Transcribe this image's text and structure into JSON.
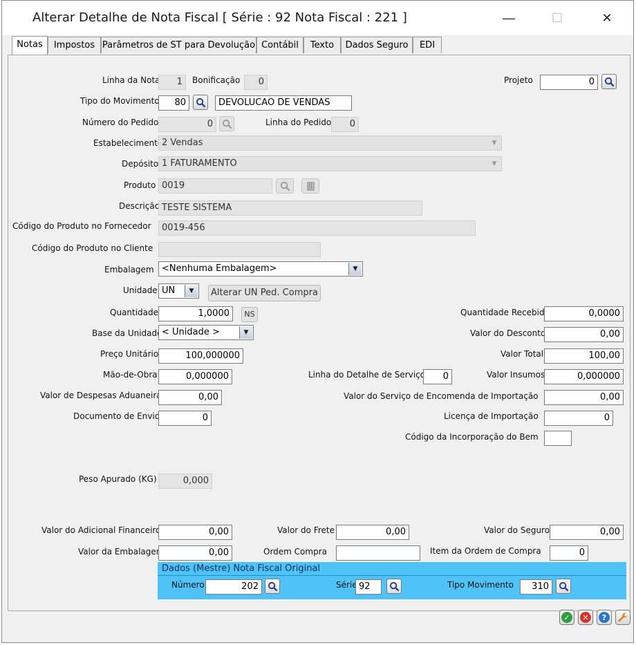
{
  "window": {
    "title": "Alterar Detalhe de Nota Fiscal [ Série : 92 Nota Fiscal : 221 ]",
    "minimize": "—",
    "maximize": "☐",
    "close": "✕"
  },
  "tabs": [
    "Notas",
    "Impostos",
    "Parâmetros de ST para Devolução",
    "Contábil",
    "Texto",
    "Dados Seguro",
    "EDI"
  ],
  "fields": {
    "linha_nota": {
      "label": "Linha da Nota",
      "value": "1"
    },
    "bonificacao": {
      "label": "Bonificação",
      "value": "0"
    },
    "projeto": {
      "label": "Projeto",
      "value": "0"
    },
    "tipo_movimento": {
      "label": "Tipo do Movimento",
      "value": "80",
      "desc": "DEVOLUCAO DE VENDAS"
    },
    "numero_pedido": {
      "label": "Número do Pedido",
      "value": "0"
    },
    "linha_pedido": {
      "label": "Linha do Pedido",
      "value": "0"
    },
    "estabelecimento": {
      "label": "Estabelecimento",
      "value": "2 Vendas"
    },
    "deposito": {
      "label": "Depósito",
      "value": "1 FATURAMENTO"
    },
    "produto": {
      "label": "Produto",
      "value": "0019"
    },
    "descricao": {
      "label": "Descrição",
      "value": "TESTE SISTEMA"
    },
    "cod_fornecedor": {
      "label": "Código do Produto no Fornecedor",
      "value": "0019-456"
    },
    "cod_cliente": {
      "label": "Código do Produto no Cliente",
      "value": ""
    },
    "embalagem": {
      "label": "Embalagem",
      "value": "<Nenhuma Embalagem>"
    },
    "unidade": {
      "label": "Unidade",
      "value": "UN",
      "button": "Alterar UN Ped. Compra"
    },
    "quantidade": {
      "label": "Quantidade",
      "value": "1,0000",
      "ns": "NS"
    },
    "quantidade_recebida": {
      "label": "Quantidade Recebida",
      "value": "0,0000"
    },
    "base_unidade": {
      "label": "Base da Unidade",
      "value": "< Unidade >"
    },
    "valor_desconto": {
      "label": "Valor do Desconto",
      "value": "0,00"
    },
    "preco_unitario": {
      "label": "Preço Unitário",
      "value": "100,000000"
    },
    "valor_total": {
      "label": "Valor Total",
      "value": "100,00"
    },
    "mao_obra": {
      "label": "Mão-de-Obra",
      "value": "0,000000"
    },
    "linha_detalhe_servico": {
      "label": "Linha do Detalhe de Serviço",
      "value": "0"
    },
    "valor_insumos": {
      "label": "Valor Insumos",
      "value": "0,000000"
    },
    "despesas_aduaneiras": {
      "label": "Valor de Despesas Aduaneiras",
      "value": "0,00"
    },
    "servico_encomenda": {
      "label": "Valor do Serviço de Encomenda de Importação",
      "value": "0,00"
    },
    "documento_envio": {
      "label": "Documento de Envio",
      "value": "0"
    },
    "licenca_importacao": {
      "label": "Licença de Importação",
      "value": "0"
    },
    "incorporacao_bem": {
      "label": "Código da Incorporação do Bem",
      "value": ""
    },
    "peso_apurado": {
      "label": "Peso Apurado (KG)",
      "value": "0,000"
    },
    "adicional_financeiro": {
      "label": "Valor do Adicional Financeiro",
      "value": "0,00"
    },
    "valor_frete": {
      "label": "Valor do Frete",
      "value": "0,00"
    },
    "valor_seguro": {
      "label": "Valor do Seguro",
      "value": "0,00"
    },
    "valor_embalagem": {
      "label": "Valor da Embalagem",
      "value": "0,00"
    },
    "ordem_compra": {
      "label": "Ordem Compra",
      "value": ""
    },
    "item_ordem_compra": {
      "label": "Item da Ordem de Compra",
      "value": "0"
    }
  },
  "nf_original": {
    "title": "Dados (Mestre) Nota Fiscal Original",
    "numero": {
      "label": "Número",
      "value": "202"
    },
    "serie": {
      "label": "Série",
      "value": "92"
    },
    "tipo_movimento": {
      "label": "Tipo Movimento",
      "value": "310"
    }
  },
  "footer_buttons": [
    {
      "name": "ok",
      "color": "#2e9e3a"
    },
    {
      "name": "cancel",
      "color": "#d9342b"
    },
    {
      "name": "help",
      "color": "#2a74c9"
    },
    {
      "name": "tools",
      "color": "#e08a1e"
    }
  ]
}
